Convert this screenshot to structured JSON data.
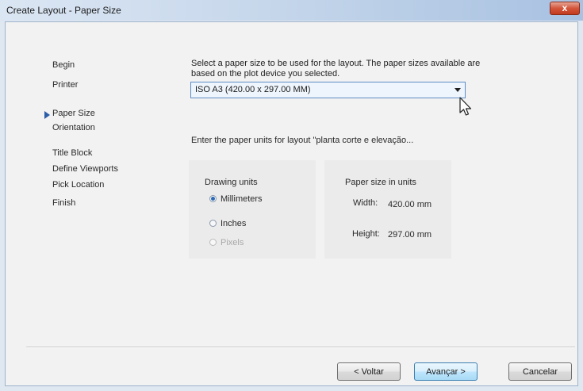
{
  "window": {
    "title": "Create Layout - Paper Size",
    "close_label": "x"
  },
  "nav": {
    "items": [
      {
        "label": "Begin"
      },
      {
        "label": "Printer"
      },
      {
        "label": "Paper Size",
        "current": true
      },
      {
        "label": "Orientation"
      },
      {
        "label": "Title Block"
      },
      {
        "label": "Define Viewports"
      },
      {
        "label": "Pick Location"
      },
      {
        "label": "Finish"
      }
    ]
  },
  "main": {
    "description": "Select a paper size to be used for the layout.  The paper sizes available are based on the plot device you selected.",
    "paper_size_value": "ISO A3 (420.00 x 297.00 MM)",
    "enter_units_text": "Enter the paper units for layout \"planta corte e elevação...",
    "drawing_units_label": "Drawing units",
    "units": [
      {
        "label": "Millimeters",
        "selected": true,
        "enabled": true
      },
      {
        "label": "Inches",
        "selected": false,
        "enabled": true
      },
      {
        "label": "Pixels",
        "selected": false,
        "enabled": false
      }
    ],
    "paper_size_units_label": "Paper size in units",
    "width_label": "Width:",
    "width_value": "420.00 mm",
    "height_label": "Height:",
    "height_value": "297.00 mm"
  },
  "buttons": {
    "back": "< Voltar",
    "next": "Avançar >",
    "cancel": "Cancelar"
  }
}
